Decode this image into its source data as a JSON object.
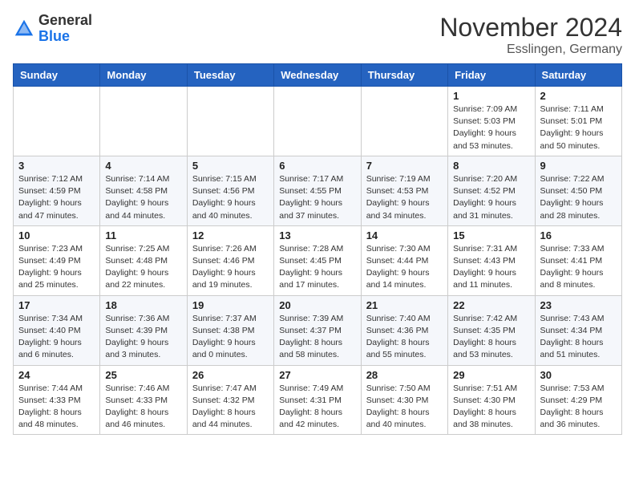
{
  "logo": {
    "general": "General",
    "blue": "Blue"
  },
  "title": {
    "month": "November 2024",
    "location": "Esslingen, Germany"
  },
  "weekdays": [
    "Sunday",
    "Monday",
    "Tuesday",
    "Wednesday",
    "Thursday",
    "Friday",
    "Saturday"
  ],
  "weeks": [
    [
      {
        "day": "",
        "info": ""
      },
      {
        "day": "",
        "info": ""
      },
      {
        "day": "",
        "info": ""
      },
      {
        "day": "",
        "info": ""
      },
      {
        "day": "",
        "info": ""
      },
      {
        "day": "1",
        "info": "Sunrise: 7:09 AM\nSunset: 5:03 PM\nDaylight: 9 hours and 53 minutes."
      },
      {
        "day": "2",
        "info": "Sunrise: 7:11 AM\nSunset: 5:01 PM\nDaylight: 9 hours and 50 minutes."
      }
    ],
    [
      {
        "day": "3",
        "info": "Sunrise: 7:12 AM\nSunset: 4:59 PM\nDaylight: 9 hours and 47 minutes."
      },
      {
        "day": "4",
        "info": "Sunrise: 7:14 AM\nSunset: 4:58 PM\nDaylight: 9 hours and 44 minutes."
      },
      {
        "day": "5",
        "info": "Sunrise: 7:15 AM\nSunset: 4:56 PM\nDaylight: 9 hours and 40 minutes."
      },
      {
        "day": "6",
        "info": "Sunrise: 7:17 AM\nSunset: 4:55 PM\nDaylight: 9 hours and 37 minutes."
      },
      {
        "day": "7",
        "info": "Sunrise: 7:19 AM\nSunset: 4:53 PM\nDaylight: 9 hours and 34 minutes."
      },
      {
        "day": "8",
        "info": "Sunrise: 7:20 AM\nSunset: 4:52 PM\nDaylight: 9 hours and 31 minutes."
      },
      {
        "day": "9",
        "info": "Sunrise: 7:22 AM\nSunset: 4:50 PM\nDaylight: 9 hours and 28 minutes."
      }
    ],
    [
      {
        "day": "10",
        "info": "Sunrise: 7:23 AM\nSunset: 4:49 PM\nDaylight: 9 hours and 25 minutes."
      },
      {
        "day": "11",
        "info": "Sunrise: 7:25 AM\nSunset: 4:48 PM\nDaylight: 9 hours and 22 minutes."
      },
      {
        "day": "12",
        "info": "Sunrise: 7:26 AM\nSunset: 4:46 PM\nDaylight: 9 hours and 19 minutes."
      },
      {
        "day": "13",
        "info": "Sunrise: 7:28 AM\nSunset: 4:45 PM\nDaylight: 9 hours and 17 minutes."
      },
      {
        "day": "14",
        "info": "Sunrise: 7:30 AM\nSunset: 4:44 PM\nDaylight: 9 hours and 14 minutes."
      },
      {
        "day": "15",
        "info": "Sunrise: 7:31 AM\nSunset: 4:43 PM\nDaylight: 9 hours and 11 minutes."
      },
      {
        "day": "16",
        "info": "Sunrise: 7:33 AM\nSunset: 4:41 PM\nDaylight: 9 hours and 8 minutes."
      }
    ],
    [
      {
        "day": "17",
        "info": "Sunrise: 7:34 AM\nSunset: 4:40 PM\nDaylight: 9 hours and 6 minutes."
      },
      {
        "day": "18",
        "info": "Sunrise: 7:36 AM\nSunset: 4:39 PM\nDaylight: 9 hours and 3 minutes."
      },
      {
        "day": "19",
        "info": "Sunrise: 7:37 AM\nSunset: 4:38 PM\nDaylight: 9 hours and 0 minutes."
      },
      {
        "day": "20",
        "info": "Sunrise: 7:39 AM\nSunset: 4:37 PM\nDaylight: 8 hours and 58 minutes."
      },
      {
        "day": "21",
        "info": "Sunrise: 7:40 AM\nSunset: 4:36 PM\nDaylight: 8 hours and 55 minutes."
      },
      {
        "day": "22",
        "info": "Sunrise: 7:42 AM\nSunset: 4:35 PM\nDaylight: 8 hours and 53 minutes."
      },
      {
        "day": "23",
        "info": "Sunrise: 7:43 AM\nSunset: 4:34 PM\nDaylight: 8 hours and 51 minutes."
      }
    ],
    [
      {
        "day": "24",
        "info": "Sunrise: 7:44 AM\nSunset: 4:33 PM\nDaylight: 8 hours and 48 minutes."
      },
      {
        "day": "25",
        "info": "Sunrise: 7:46 AM\nSunset: 4:33 PM\nDaylight: 8 hours and 46 minutes."
      },
      {
        "day": "26",
        "info": "Sunrise: 7:47 AM\nSunset: 4:32 PM\nDaylight: 8 hours and 44 minutes."
      },
      {
        "day": "27",
        "info": "Sunrise: 7:49 AM\nSunset: 4:31 PM\nDaylight: 8 hours and 42 minutes."
      },
      {
        "day": "28",
        "info": "Sunrise: 7:50 AM\nSunset: 4:30 PM\nDaylight: 8 hours and 40 minutes."
      },
      {
        "day": "29",
        "info": "Sunrise: 7:51 AM\nSunset: 4:30 PM\nDaylight: 8 hours and 38 minutes."
      },
      {
        "day": "30",
        "info": "Sunrise: 7:53 AM\nSunset: 4:29 PM\nDaylight: 8 hours and 36 minutes."
      }
    ]
  ]
}
